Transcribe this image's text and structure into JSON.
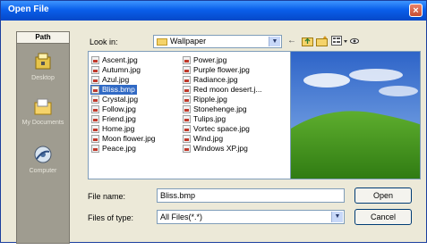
{
  "window": {
    "title": "Open File",
    "close_glyph": "×"
  },
  "places": {
    "header": "Path",
    "items": [
      {
        "label": "Desktop",
        "icon": "desktop-icon"
      },
      {
        "label": "My Documents",
        "icon": "my-documents-icon"
      },
      {
        "label": "Computer",
        "icon": "computer-icon"
      }
    ]
  },
  "look_in": {
    "label": "Look in:",
    "value": "Wallpaper"
  },
  "toolbar": {
    "back": "←",
    "up": "up-folder-icon",
    "new_folder": "new-folder-icon",
    "view": "view-menu-icon"
  },
  "files": {
    "col1": [
      "Ascent.jpg",
      "Autumn.jpg",
      "Azul.jpg",
      "Bliss.bmp",
      "Crystal.jpg",
      "Follow.jpg",
      "Friend.jpg",
      "Home.jpg",
      "Moon flower.jpg",
      "Peace.jpg"
    ],
    "col2": [
      "Power.jpg",
      "Purple flower.jpg",
      "Radiance.jpg",
      "Red moon desert.j...",
      "Ripple.jpg",
      "Stonehenge.jpg",
      "Tulips.jpg",
      "Vortec space.jpg",
      "Wind.jpg",
      "Windows XP.jpg"
    ],
    "selected": "Bliss.bmp"
  },
  "file_name": {
    "label": "File name:",
    "value": "Bliss.bmp"
  },
  "file_type": {
    "label": "Files of type:",
    "value": "All Files(*.*)"
  },
  "buttons": {
    "open": "Open",
    "cancel": "Cancel"
  },
  "colors": {
    "title_bar": "#0A5FEA",
    "selection": "#316AC5",
    "dialog_bg": "#ECE9D8"
  }
}
